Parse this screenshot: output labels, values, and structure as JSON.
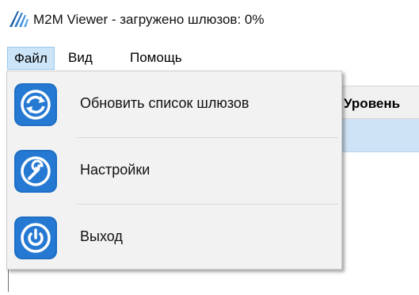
{
  "window": {
    "title": "M2M Viewer - загружено шлюзов: 0%",
    "app_icon": "m2m-logo-icon"
  },
  "menubar": {
    "items": [
      {
        "label": "Файл",
        "active": true
      },
      {
        "label": "Вид",
        "active": false
      },
      {
        "label": "Помощь",
        "active": false
      }
    ]
  },
  "file_menu": {
    "items": [
      {
        "label": "Обновить список шлюзов",
        "icon": "refresh-icon"
      },
      {
        "label": "Настройки",
        "icon": "wrench-icon"
      },
      {
        "label": "Выход",
        "icon": "power-icon"
      }
    ]
  },
  "grid": {
    "column_header": "Уровень"
  },
  "colors": {
    "menu_highlight": "#cce4f7",
    "icon_blue": "#1f6fc5",
    "dropdown_bg": "#f2f2f2",
    "selected_row": "#cfe3f6"
  }
}
